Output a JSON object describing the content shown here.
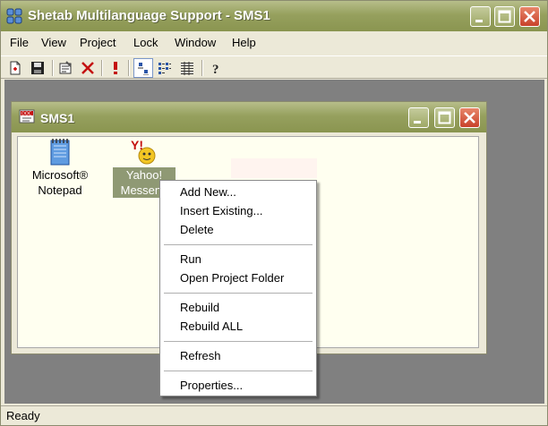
{
  "window": {
    "title": "Shetab Multilanguage Support - SMS1"
  },
  "menubar": {
    "items": [
      "File",
      "View",
      "Project",
      "Lock",
      "Window",
      "Help"
    ]
  },
  "toolbar": {
    "buttons": [
      "new-document-icon",
      "save-icon",
      "properties-icon",
      "delete-icon",
      "run-icon",
      "view-large-icons-icon",
      "view-list-icon",
      "view-details-icon",
      "help-icon"
    ],
    "active_view": "view-large-icons-icon"
  },
  "child_window": {
    "title": "SMS1",
    "items": [
      {
        "label_line1": "Microsoft®",
        "label_line2": "Notepad",
        "icon": "notepad-icon",
        "selected": false
      },
      {
        "label_line1": "Yahoo!",
        "label_line2": "Messeng",
        "icon": "yahoo-messenger-icon",
        "selected": true
      }
    ]
  },
  "context_menu": {
    "groups": [
      [
        "Add New...",
        "Insert Existing...",
        "Delete"
      ],
      [
        "Run",
        "Open Project Folder"
      ],
      [
        "Rebuild",
        "Rebuild ALL"
      ],
      [
        "Refresh"
      ],
      [
        "Properties..."
      ]
    ]
  },
  "statusbar": {
    "text": "Ready"
  },
  "colors": {
    "titlebar": "#96a05e",
    "mdi_background": "#808080",
    "client_background": "#fffff0",
    "selection": "#8f9974"
  }
}
